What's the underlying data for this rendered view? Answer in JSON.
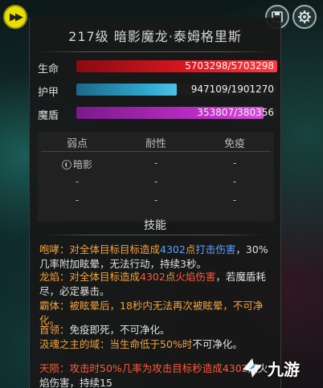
{
  "header": {
    "title": "217级  暗影魔龙·泰姆格里斯"
  },
  "stats": [
    {
      "label": "生命",
      "current": 5703298,
      "max": 5703298,
      "text": "5703298/5703298",
      "fill": 1.0
    },
    {
      "label": "护甲",
      "current": 947109,
      "max": 1901270,
      "text": "947109/1901270",
      "fill": 0.498
    },
    {
      "label": "魔盾",
      "current": 353807,
      "max": 380356,
      "text": "353807/380356",
      "fill": 0.93
    }
  ],
  "resistances": {
    "headers": [
      "弱点",
      "耐性",
      "免疫"
    ],
    "rows": [
      [
        "暗影",
        "-",
        "-"
      ],
      [
        "-",
        "-",
        "-"
      ],
      [
        "-",
        "-",
        "-"
      ]
    ]
  },
  "skills_title": "技能",
  "skills": [
    {
      "name": "咆哮",
      "parts": [
        {
          "t": "咆哮：",
          "c": "s-orange"
        },
        {
          "t": "对全体目标目标造成",
          "c": "s-orange"
        },
        {
          "t": "4302",
          "c": "s-blue"
        },
        {
          "t": "点",
          "c": "s-orange"
        },
        {
          "t": "打击伤害",
          "c": "s-blue"
        },
        {
          "t": "，30%几率附加眩晕，无法行动，持续3秒。",
          "c": "s-white"
        }
      ]
    },
    {
      "name": "龙焰",
      "parts": [
        {
          "t": "龙焰：",
          "c": "s-orange"
        },
        {
          "t": "对全体目标造成",
          "c": "s-orange"
        },
        {
          "t": "4302",
          "c": "s-red"
        },
        {
          "t": "点",
          "c": "s-orange"
        },
        {
          "t": "火焰伤害",
          "c": "s-red"
        },
        {
          "t": "，若魔盾耗尽，必定暴击。",
          "c": "s-white"
        }
      ]
    },
    {
      "name": "霸体",
      "parts": [
        {
          "t": "霸体：被眩晕后，18秒内无法再次被眩晕，不可净化。",
          "c": "s-orange"
        }
      ]
    },
    {
      "name": "首领",
      "parts": [
        {
          "t": "首领：",
          "c": "s-orange"
        },
        {
          "t": "免疫即死，不可净化。",
          "c": "s-white"
        }
      ]
    },
    {
      "name": "汲魂之主的域",
      "parts": [
        {
          "t": "汲魂之主的域：",
          "c": "s-orange"
        },
        {
          "t": "当生命低于50%时",
          "c": "s-orange"
        },
        {
          "t": "不可净化。",
          "c": "s-white"
        }
      ]
    },
    {
      "name": "天陨",
      "parts": [
        {
          "t": "天陨：攻击时50%几率为攻击目标",
          "c": "s-red"
        },
        {
          "t": "秒造成",
          "c": "s-red"
        },
        {
          "t": "4302",
          "c": "s-red"
        },
        {
          "t": "点火焰伤害，持续15",
          "c": "s-white"
        }
      ]
    }
  ],
  "watermark": "九游",
  "icons": {
    "fast_forward": "fast-forward-icon",
    "save": "save-icon",
    "settings": "gear-icon"
  }
}
